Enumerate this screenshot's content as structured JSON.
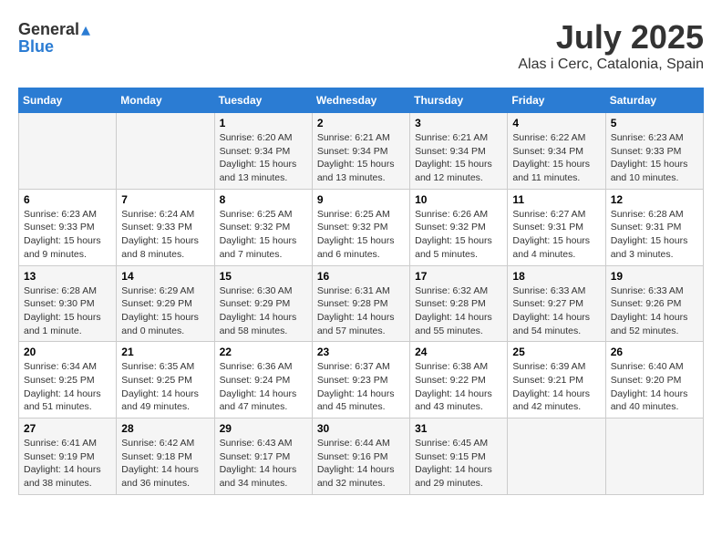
{
  "header": {
    "logo_general": "General",
    "logo_blue": "Blue",
    "month": "July 2025",
    "location": "Alas i Cerc, Catalonia, Spain"
  },
  "days_of_week": [
    "Sunday",
    "Monday",
    "Tuesday",
    "Wednesday",
    "Thursday",
    "Friday",
    "Saturday"
  ],
  "weeks": [
    [
      {
        "day": "",
        "info": ""
      },
      {
        "day": "",
        "info": ""
      },
      {
        "day": "1",
        "info": "Sunrise: 6:20 AM\nSunset: 9:34 PM\nDaylight: 15 hours\nand 13 minutes."
      },
      {
        "day": "2",
        "info": "Sunrise: 6:21 AM\nSunset: 9:34 PM\nDaylight: 15 hours\nand 13 minutes."
      },
      {
        "day": "3",
        "info": "Sunrise: 6:21 AM\nSunset: 9:34 PM\nDaylight: 15 hours\nand 12 minutes."
      },
      {
        "day": "4",
        "info": "Sunrise: 6:22 AM\nSunset: 9:34 PM\nDaylight: 15 hours\nand 11 minutes."
      },
      {
        "day": "5",
        "info": "Sunrise: 6:23 AM\nSunset: 9:33 PM\nDaylight: 15 hours\nand 10 minutes."
      }
    ],
    [
      {
        "day": "6",
        "info": "Sunrise: 6:23 AM\nSunset: 9:33 PM\nDaylight: 15 hours\nand 9 minutes."
      },
      {
        "day": "7",
        "info": "Sunrise: 6:24 AM\nSunset: 9:33 PM\nDaylight: 15 hours\nand 8 minutes."
      },
      {
        "day": "8",
        "info": "Sunrise: 6:25 AM\nSunset: 9:32 PM\nDaylight: 15 hours\nand 7 minutes."
      },
      {
        "day": "9",
        "info": "Sunrise: 6:25 AM\nSunset: 9:32 PM\nDaylight: 15 hours\nand 6 minutes."
      },
      {
        "day": "10",
        "info": "Sunrise: 6:26 AM\nSunset: 9:32 PM\nDaylight: 15 hours\nand 5 minutes."
      },
      {
        "day": "11",
        "info": "Sunrise: 6:27 AM\nSunset: 9:31 PM\nDaylight: 15 hours\nand 4 minutes."
      },
      {
        "day": "12",
        "info": "Sunrise: 6:28 AM\nSunset: 9:31 PM\nDaylight: 15 hours\nand 3 minutes."
      }
    ],
    [
      {
        "day": "13",
        "info": "Sunrise: 6:28 AM\nSunset: 9:30 PM\nDaylight: 15 hours\nand 1 minute."
      },
      {
        "day": "14",
        "info": "Sunrise: 6:29 AM\nSunset: 9:29 PM\nDaylight: 15 hours\nand 0 minutes."
      },
      {
        "day": "15",
        "info": "Sunrise: 6:30 AM\nSunset: 9:29 PM\nDaylight: 14 hours\nand 58 minutes."
      },
      {
        "day": "16",
        "info": "Sunrise: 6:31 AM\nSunset: 9:28 PM\nDaylight: 14 hours\nand 57 minutes."
      },
      {
        "day": "17",
        "info": "Sunrise: 6:32 AM\nSunset: 9:28 PM\nDaylight: 14 hours\nand 55 minutes."
      },
      {
        "day": "18",
        "info": "Sunrise: 6:33 AM\nSunset: 9:27 PM\nDaylight: 14 hours\nand 54 minutes."
      },
      {
        "day": "19",
        "info": "Sunrise: 6:33 AM\nSunset: 9:26 PM\nDaylight: 14 hours\nand 52 minutes."
      }
    ],
    [
      {
        "day": "20",
        "info": "Sunrise: 6:34 AM\nSunset: 9:25 PM\nDaylight: 14 hours\nand 51 minutes."
      },
      {
        "day": "21",
        "info": "Sunrise: 6:35 AM\nSunset: 9:25 PM\nDaylight: 14 hours\nand 49 minutes."
      },
      {
        "day": "22",
        "info": "Sunrise: 6:36 AM\nSunset: 9:24 PM\nDaylight: 14 hours\nand 47 minutes."
      },
      {
        "day": "23",
        "info": "Sunrise: 6:37 AM\nSunset: 9:23 PM\nDaylight: 14 hours\nand 45 minutes."
      },
      {
        "day": "24",
        "info": "Sunrise: 6:38 AM\nSunset: 9:22 PM\nDaylight: 14 hours\nand 43 minutes."
      },
      {
        "day": "25",
        "info": "Sunrise: 6:39 AM\nSunset: 9:21 PM\nDaylight: 14 hours\nand 42 minutes."
      },
      {
        "day": "26",
        "info": "Sunrise: 6:40 AM\nSunset: 9:20 PM\nDaylight: 14 hours\nand 40 minutes."
      }
    ],
    [
      {
        "day": "27",
        "info": "Sunrise: 6:41 AM\nSunset: 9:19 PM\nDaylight: 14 hours\nand 38 minutes."
      },
      {
        "day": "28",
        "info": "Sunrise: 6:42 AM\nSunset: 9:18 PM\nDaylight: 14 hours\nand 36 minutes."
      },
      {
        "day": "29",
        "info": "Sunrise: 6:43 AM\nSunset: 9:17 PM\nDaylight: 14 hours\nand 34 minutes."
      },
      {
        "day": "30",
        "info": "Sunrise: 6:44 AM\nSunset: 9:16 PM\nDaylight: 14 hours\nand 32 minutes."
      },
      {
        "day": "31",
        "info": "Sunrise: 6:45 AM\nSunset: 9:15 PM\nDaylight: 14 hours\nand 29 minutes."
      },
      {
        "day": "",
        "info": ""
      },
      {
        "day": "",
        "info": ""
      }
    ]
  ]
}
